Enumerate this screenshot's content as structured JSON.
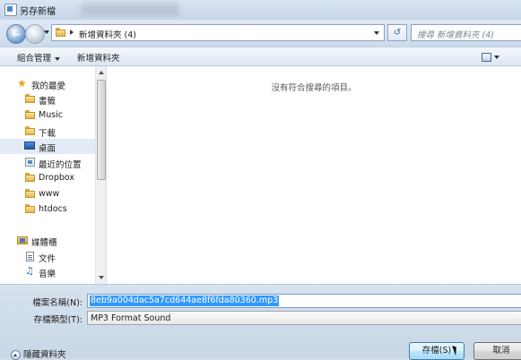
{
  "window": {
    "title": "另存新檔"
  },
  "address": {
    "path": "新增資料夾 (4)",
    "search_placeholder": "搜尋 新增資料夾 (4)"
  },
  "toolbar": {
    "organize": "組合管理",
    "new_folder": "新增資料夾"
  },
  "nav": {
    "favorites": {
      "label": "我的最愛",
      "items": [
        "書籤",
        "Music",
        "下載",
        "桌面",
        "最近的位置",
        "Dropbox",
        "www",
        "htdocs"
      ]
    },
    "libraries": {
      "label": "媒體櫃",
      "items": [
        "文件",
        "音樂"
      ]
    }
  },
  "content": {
    "empty_message": "沒有符合搜尋的項目。"
  },
  "form": {
    "filename_label": "檔案名稱(N):",
    "filename_value": "8eb9a004dac5a7cd644ae8f6fda80360.mp3",
    "filetype_label": "存檔類型(T):",
    "filetype_value": "MP3 Format Sound"
  },
  "footer": {
    "hide_folders": "隱藏資料夾",
    "save": "存檔(S)",
    "cancel": "取消"
  }
}
